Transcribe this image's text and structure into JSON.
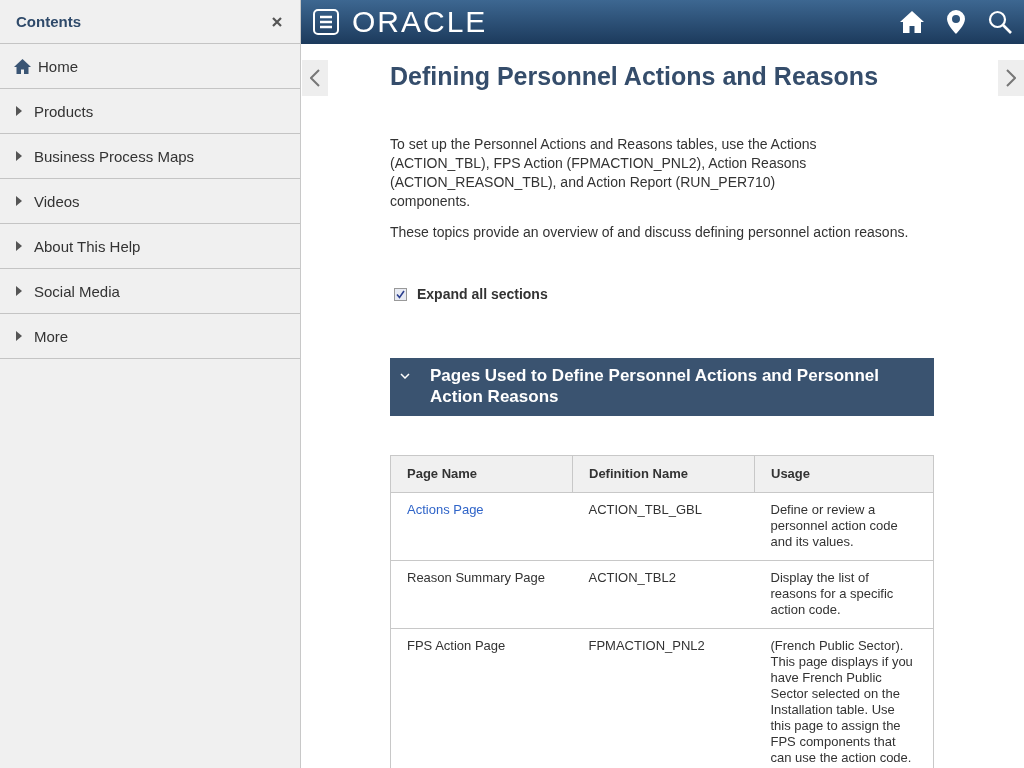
{
  "sidebar": {
    "title": "Contents",
    "items": [
      {
        "label": "Home",
        "kind": "home"
      },
      {
        "label": "Products",
        "kind": "folder"
      },
      {
        "label": "Business Process Maps",
        "kind": "folder"
      },
      {
        "label": "Videos",
        "kind": "folder"
      },
      {
        "label": "About This Help",
        "kind": "folder"
      },
      {
        "label": "Social Media",
        "kind": "folder"
      },
      {
        "label": "More",
        "kind": "folder"
      }
    ]
  },
  "header": {
    "logo": "ORACLE"
  },
  "page": {
    "title": "Defining Personnel Actions and Reasons",
    "paragraphs": [
      "To set up the Personnel Actions and Reasons tables, use the Actions (ACTION_TBL), FPS Action (FPMACTION_PNL2), Action Reasons (ACTION_REASON_TBL), and Action Report (RUN_PER710) components.",
      "These topics provide an overview of and discuss defining personnel action reasons."
    ],
    "expand_all": {
      "label": "Expand all sections",
      "checked": true
    },
    "section": {
      "title": "Pages Used to Define Personnel Actions and Personnel Action Reasons",
      "expanded": true,
      "table": {
        "columns": [
          "Page Name",
          "Definition Name",
          "Usage"
        ],
        "rows": [
          {
            "page_name": "Actions Page",
            "link": true,
            "definition": "ACTION_TBL_GBL",
            "usage": "Define or review a personnel action code and its values."
          },
          {
            "page_name": "Reason Summary Page",
            "link": false,
            "definition": "ACTION_TBL2",
            "usage": "Display the list of reasons for a specific action code."
          },
          {
            "page_name": "FPS Action Page",
            "link": false,
            "definition": "FPMACTION_PNL2",
            "usage": "(French Public Sector). This page displays if you have French Public Sector selected on the Installation table. Use this page to assign the FPS components that can use the action code."
          }
        ]
      }
    }
  }
}
